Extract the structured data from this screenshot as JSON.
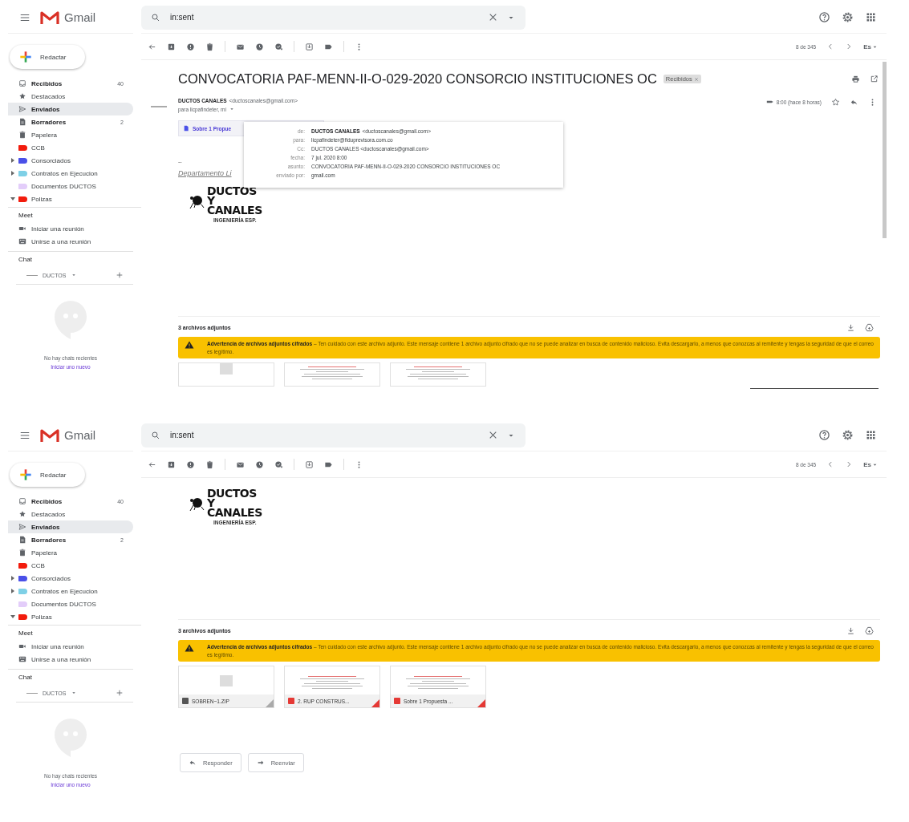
{
  "screens": [
    {
      "app_name": "Gmail",
      "compose": "Redactar",
      "search": {
        "value": "in:sent"
      },
      "nav": [
        {
          "kind": "inbox",
          "label": "Recibidos",
          "count": "40",
          "unread": true,
          "selected": false
        },
        {
          "kind": "starred",
          "label": "Destacados",
          "unread": false,
          "selected": false
        },
        {
          "kind": "sent",
          "label": "Enviados",
          "unread": false,
          "selected": true
        },
        {
          "kind": "drafts",
          "label": "Borradores",
          "count": "2",
          "unread": true,
          "selected": false
        },
        {
          "kind": "trash",
          "label": "Papelera",
          "unread": false,
          "selected": false
        },
        {
          "kind": "label",
          "label": "CCB",
          "color": "#f21c0d",
          "expandable": false,
          "unread": false,
          "selected": false
        },
        {
          "kind": "label",
          "label": "Consorciados",
          "color": "#4a50e8",
          "expandable": true,
          "expanded": false,
          "unread": false,
          "selected": false
        },
        {
          "kind": "label",
          "label": "Contratos en Ejecucion",
          "color": "#7ed0e6",
          "expandable": true,
          "expanded": false,
          "unread": false,
          "selected": false
        },
        {
          "kind": "label",
          "label": "Documentos DUCTOS",
          "color": "#e3cdfa",
          "expandable": false,
          "unread": false,
          "selected": false
        },
        {
          "kind": "label",
          "label": "Polizas",
          "color": "#f21c0d",
          "expandable": true,
          "expanded": true,
          "unread": false,
          "selected": false
        }
      ],
      "meet": {
        "title": "Meet",
        "items": [
          {
            "kind": "video",
            "label": "Iniciar una reunión"
          },
          {
            "kind": "keyboard",
            "label": "Unirse a una reunión"
          }
        ]
      },
      "chat": {
        "title": "Chat",
        "user": "DUCTOS",
        "empty": "No hay chats recientes",
        "link": "Iniciar uno nuevo"
      },
      "pager": "8 de 345",
      "input_tool": "Es",
      "message": {
        "subject": "CONVOCATORIA PAF-MENN-II-O-029-2020 CONSORCIO INSTITUCIONES OC",
        "label_chip": "Recibidos",
        "sender_name": "DUCTOS CANALES",
        "sender_email": "<ductoscanales@gmail.com>",
        "to": "para licpafindeter, mí",
        "time": "8:00 (hace 8 horas)",
        "attachment_chip": "Sobre 1 Propue",
        "signature": "--",
        "department": "Departamento Li",
        "details": [
          {
            "label": "de:",
            "name": "DUCTOS CANALES",
            "value": "<ductoscanales@gmail.com>"
          },
          {
            "label": "para:",
            "value": "licpafindeter@fiduprevisora.com.co"
          },
          {
            "label": "Cc:",
            "value": "DUCTOS CANALES <ductoscanales@gmail.com>"
          },
          {
            "label": "fecha:",
            "value": "7 jul. 2020 8:00"
          },
          {
            "label": "asunto:",
            "value": "CONVOCATORIA PAF-MENN-II-O-029-2020 CONSORCIO INSTITUCIONES OC"
          },
          {
            "label": "enviado por:",
            "value": "gmail.com"
          }
        ],
        "logo": {
          "lines": [
            "DUCTOS",
            "Y",
            "CANALES"
          ],
          "tagline": "INGENIERÍA ESP."
        },
        "attachments_title": "3 archivos adjuntos",
        "warning": "**Advertencia de archivos adjuntos cifrados** – Ten cuidado con este archivo adjunto. Este mensaje contiene 1 archivo adjunto cifrado que no se puede analizar en busca de contenido malicioso. Evita descargarlo, a menos que conozcas al remitente y tengas la seguridad de que el correo es legítimo.",
        "attachments": [
          {
            "kind": "zip"
          },
          {
            "kind": "pdf"
          },
          {
            "kind": "pdf"
          }
        ]
      }
    },
    {
      "app_name": "Gmail",
      "compose": "Redactar",
      "search": {
        "value": "in:sent"
      },
      "nav": [
        {
          "kind": "inbox",
          "label": "Recibidos",
          "count": "40",
          "unread": true,
          "selected": false
        },
        {
          "kind": "starred",
          "label": "Destacados",
          "unread": false,
          "selected": false
        },
        {
          "kind": "sent",
          "label": "Enviados",
          "unread": false,
          "selected": true
        },
        {
          "kind": "drafts",
          "label": "Borradores",
          "count": "2",
          "unread": true,
          "selected": false
        },
        {
          "kind": "trash",
          "label": "Papelera",
          "unread": false,
          "selected": false
        },
        {
          "kind": "label",
          "label": "CCB",
          "color": "#f21c0d",
          "expandable": false,
          "unread": false,
          "selected": false
        },
        {
          "kind": "label",
          "label": "Consorciados",
          "color": "#4a50e8",
          "expandable": true,
          "expanded": false,
          "unread": false,
          "selected": false
        },
        {
          "kind": "label",
          "label": "Contratos en Ejecucion",
          "color": "#7ed0e6",
          "expandable": true,
          "expanded": false,
          "unread": false,
          "selected": false
        },
        {
          "kind": "label",
          "label": "Documentos DUCTOS",
          "color": "#e3cdfa",
          "expandable": false,
          "unread": false,
          "selected": false
        },
        {
          "kind": "label",
          "label": "Polizas",
          "color": "#f21c0d",
          "expandable": true,
          "expanded": true,
          "unread": false,
          "selected": false
        }
      ],
      "meet": {
        "title": "Meet",
        "items": [
          {
            "kind": "video",
            "label": "Iniciar una reunión"
          },
          {
            "kind": "keyboard",
            "label": "Unirse a una reunión"
          }
        ]
      },
      "chat": {
        "title": "Chat",
        "user": "DUCTOS",
        "empty": "No hay chats recientes",
        "link": "Iniciar uno nuevo"
      },
      "pager": "8 de 345",
      "input_tool": "Es",
      "message": {
        "logo": {
          "lines": [
            "DUCTOS",
            "Y",
            "CANALES"
          ],
          "tagline": "INGENIERÍA ESP."
        },
        "attachments_title": "3 archivos adjuntos",
        "warning": "**Advertencia de archivos adjuntos cifrados** – Ten cuidado con este archivo adjunto. Este mensaje contiene 1 archivo adjunto cifrado que no se puede analizar en busca de contenido malicioso. Evita descargarlo, a menos que conozcas al remitente y tengas la seguridad de que el correo es legítimo.",
        "attachments": [
          {
            "kind": "zip",
            "name": "SOBREN~1.ZIP"
          },
          {
            "kind": "pdf",
            "name": "2. RUP CONSTRUS..."
          },
          {
            "kind": "pdf",
            "name": "Sobre 1 Propuesta ..."
          }
        ],
        "actions": [
          {
            "kind": "reply",
            "label": "Responder"
          },
          {
            "kind": "forward",
            "label": "Reenviar"
          }
        ]
      }
    }
  ]
}
